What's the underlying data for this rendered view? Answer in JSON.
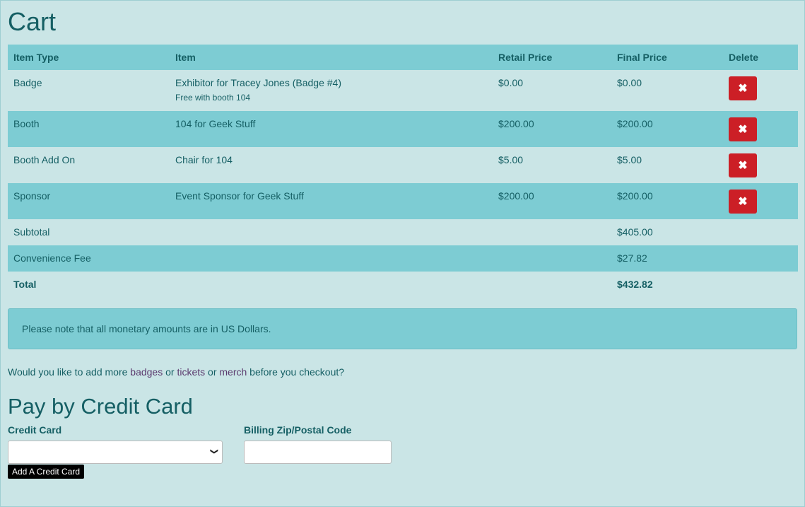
{
  "cart": {
    "title": "Cart",
    "headers": {
      "item_type": "Item Type",
      "item": "Item",
      "retail_price": "Retail Price",
      "final_price": "Final Price",
      "delete": "Delete"
    },
    "rows": [
      {
        "item_type": "Badge",
        "item": "Exhibitor for Tracey Jones (Badge #4)",
        "note": "Free with booth 104",
        "retail": "$0.00",
        "final": "$0.00"
      },
      {
        "item_type": "Booth",
        "item": "104 for Geek Stuff",
        "retail": "$200.00",
        "final": "$200.00"
      },
      {
        "item_type": "Booth Add On",
        "item": "Chair for 104",
        "retail": "$5.00",
        "final": "$5.00"
      },
      {
        "item_type": "Sponsor",
        "item": "Event Sponsor for Geek Stuff",
        "retail": "$200.00",
        "final": "$200.00"
      }
    ],
    "delete_icon": "✖",
    "subtotal_label": "Subtotal",
    "subtotal": "$405.00",
    "fee_label": "Convenience Fee",
    "fee": "$27.82",
    "total_label": "Total",
    "total": "$432.82"
  },
  "notice": "Please note that all monetary amounts are in US Dollars.",
  "more": {
    "prefix": "Would you like to add more ",
    "badges": "badges",
    "or1": " or ",
    "tickets": "tickets",
    "or2": " or ",
    "merch": "merch",
    "suffix": " before you checkout?"
  },
  "pay": {
    "title": "Pay by Credit Card",
    "card_label": "Credit Card",
    "card_value": "",
    "zip_label": "Billing Zip/Postal Code",
    "zip_value": "",
    "add_card": "Add A Credit Card"
  },
  "colors": {
    "background": "#cae5e6",
    "row_alt": "#7dccd3",
    "text": "#155f64",
    "delete": "#cc1f26",
    "link": "#5b3a6e"
  }
}
